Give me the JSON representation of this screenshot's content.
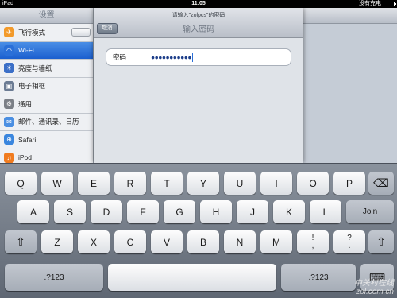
{
  "statusbar": {
    "device": "iPad",
    "time": "11:05",
    "battery": "没有充电"
  },
  "sidebar": {
    "title": "设置",
    "items": [
      {
        "label": "飞行模式",
        "icon": "airplane-icon",
        "color": "#f29a2b"
      },
      {
        "label": "Wi-Fi",
        "icon": "wifi-icon",
        "color": "#2a6fd8"
      },
      {
        "label": "亮度与墙纸",
        "icon": "brightness-icon",
        "color": "#3b6fc7"
      },
      {
        "label": "电子相框",
        "icon": "picture-frame-icon",
        "color": "#6b7b93"
      },
      {
        "label": "通用",
        "icon": "general-icon",
        "color": "#7b7f86"
      },
      {
        "label": "邮件、通讯录、日历",
        "icon": "mail-icon",
        "color": "#4b8fe2"
      },
      {
        "label": "Safari",
        "icon": "safari-icon",
        "color": "#3a86de"
      },
      {
        "label": "iPod",
        "icon": "ipod-icon",
        "color": "#f07b1f"
      }
    ]
  },
  "modal": {
    "prompt": "请输入\"zolpcs\"的密码",
    "title": "输入密码",
    "cancel": "取消",
    "field_label": "密码",
    "field_value": "●●●●●●●●●●●"
  },
  "keyboard": {
    "row1": [
      "Q",
      "W",
      "E",
      "R",
      "T",
      "Y",
      "U",
      "I",
      "O",
      "P"
    ],
    "row2": [
      "A",
      "S",
      "D",
      "F",
      "G",
      "H",
      "J",
      "K",
      "L"
    ],
    "row3": [
      "Z",
      "X",
      "C",
      "V",
      "B",
      "N",
      "M"
    ],
    "row3_punct": [
      [
        "!",
        ","
      ],
      [
        "?",
        "."
      ]
    ],
    "join": "Join",
    "numbers": ".?123"
  },
  "watermark": {
    "line1": "中关村在线",
    "line2": "zol.com.cn"
  },
  "colors": {
    "accent": "#2a6fd8",
    "selected_row": "#1b5fcf"
  }
}
